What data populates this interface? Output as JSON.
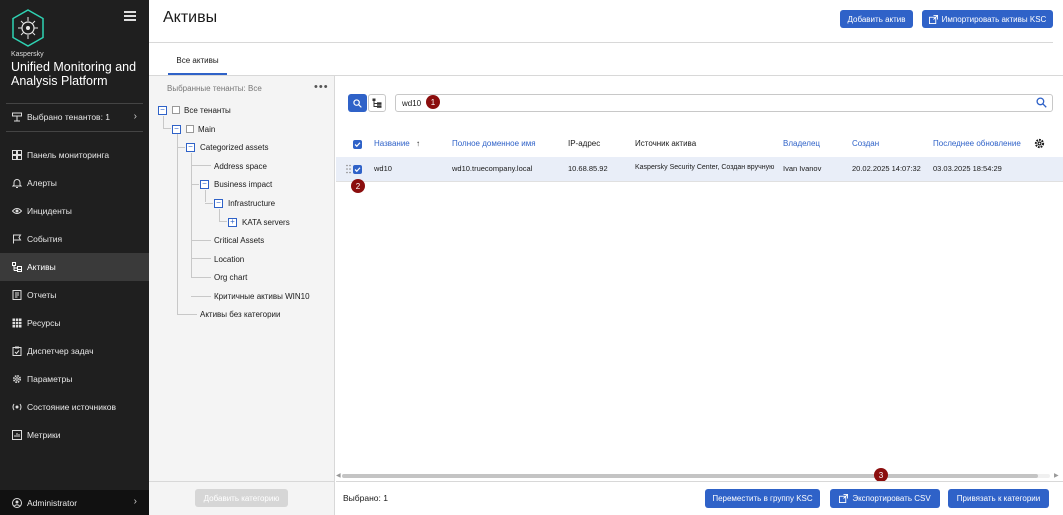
{
  "sidebar": {
    "brand_small": "Kaspersky",
    "brand_big": "Unified Monitoring and Analysis Platform",
    "tenants_label": "Выбрано тенантов: 1",
    "items": [
      {
        "label": "Панель мониторинга",
        "icon": "dashboard-icon"
      },
      {
        "label": "Алерты",
        "icon": "bell-icon"
      },
      {
        "label": "Инциденты",
        "icon": "eye-icon"
      },
      {
        "label": "События",
        "icon": "flag-icon"
      },
      {
        "label": "Активы",
        "icon": "assets-icon",
        "active": true
      },
      {
        "label": "Отчеты",
        "icon": "report-icon"
      },
      {
        "label": "Ресурсы",
        "icon": "grid-icon"
      },
      {
        "label": "Диспетчер задач",
        "icon": "task-icon"
      },
      {
        "label": "Параметры",
        "icon": "gear-icon"
      },
      {
        "label": "Состояние источников",
        "icon": "sources-icon"
      },
      {
        "label": "Метрики",
        "icon": "metrics-icon"
      }
    ],
    "user": "Administrator"
  },
  "header": {
    "title": "Активы",
    "add_asset_label": "Добавить актив",
    "import_label": "Импортировать активы KSC"
  },
  "tabs": {
    "all_assets": "Все активы"
  },
  "tree": {
    "tenants_label": "Выбранные тенанты: Все",
    "nodes": {
      "all_tenants": "Все тенанты",
      "main": "Main",
      "categorized": "Categorized assets",
      "address_space": "Address space",
      "business_impact": "Business impact",
      "infrastructure": "Infrastructure",
      "kata": "KATA servers",
      "critical": "Critical Assets",
      "location": "Location",
      "org_chart": "Org chart",
      "critical_win10": "Критичные активы WIN10",
      "uncategorized": "Активы без категории"
    },
    "add_category_label": "Добавить категорию"
  },
  "search": {
    "value": "wd10"
  },
  "table": {
    "headers": {
      "name": "Название",
      "fqdn": "Полное доменное имя",
      "ip": "IP-адрес",
      "source": "Источник актива",
      "owner": "Владелец",
      "created": "Создан",
      "updated": "Последнее обновление"
    },
    "rows": [
      {
        "name": "wd10",
        "fqdn": "wd10.truecompany.local",
        "ip": "10.68.85.92",
        "source": "Kaspersky Security Center,  Создан вручную",
        "owner": "Ivan Ivanov",
        "created": "20.02.2025 14:07:32",
        "updated": "03.03.2025 18:54:29"
      }
    ]
  },
  "markers": [
    "1",
    "2",
    "3"
  ],
  "footer": {
    "selected": "Выбрано: 1",
    "move_label": "Переместить в группу KSC",
    "export_label": "Экспортировать CSV",
    "link_label": "Привязать к категории"
  },
  "colors": {
    "accent": "#2f62c8",
    "sidebar_bg": "#1f1f1f",
    "marker": "#8b0e0e"
  }
}
